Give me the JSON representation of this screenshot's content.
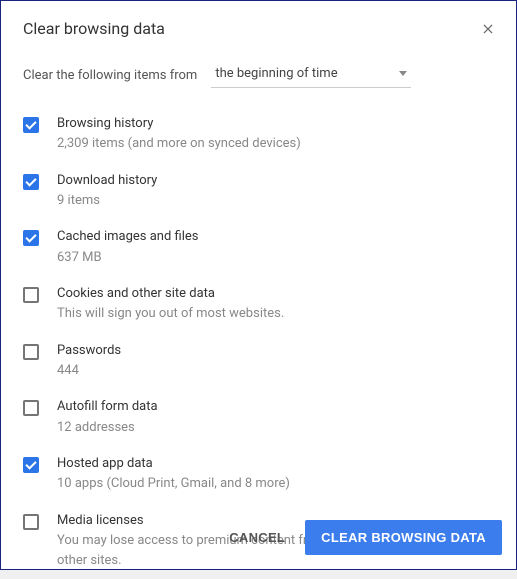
{
  "dialog": {
    "title": "Clear browsing data",
    "timeframe_label": "Clear the following items from",
    "timeframe_selected": "the beginning of time",
    "items": [
      {
        "label": "Browsing history",
        "sub": "2,309 items (and more on synced devices)",
        "checked": true
      },
      {
        "label": "Download history",
        "sub": "9 items",
        "checked": true
      },
      {
        "label": "Cached images and files",
        "sub": "637 MB",
        "checked": true
      },
      {
        "label": "Cookies and other site data",
        "sub": "This will sign you out of most websites.",
        "checked": false
      },
      {
        "label": "Passwords",
        "sub": "444",
        "checked": false
      },
      {
        "label": "Autofill form data",
        "sub": "12 addresses",
        "checked": false
      },
      {
        "label": "Hosted app data",
        "sub": "10 apps (Cloud Print, Gmail, and 8 more)",
        "checked": true
      },
      {
        "label": "Media licenses",
        "sub": "You may lose access to premium content from www.netflix.com and some other sites.",
        "checked": false
      }
    ],
    "buttons": {
      "cancel": "CANCEL",
      "confirm": "CLEAR BROWSING DATA"
    }
  }
}
